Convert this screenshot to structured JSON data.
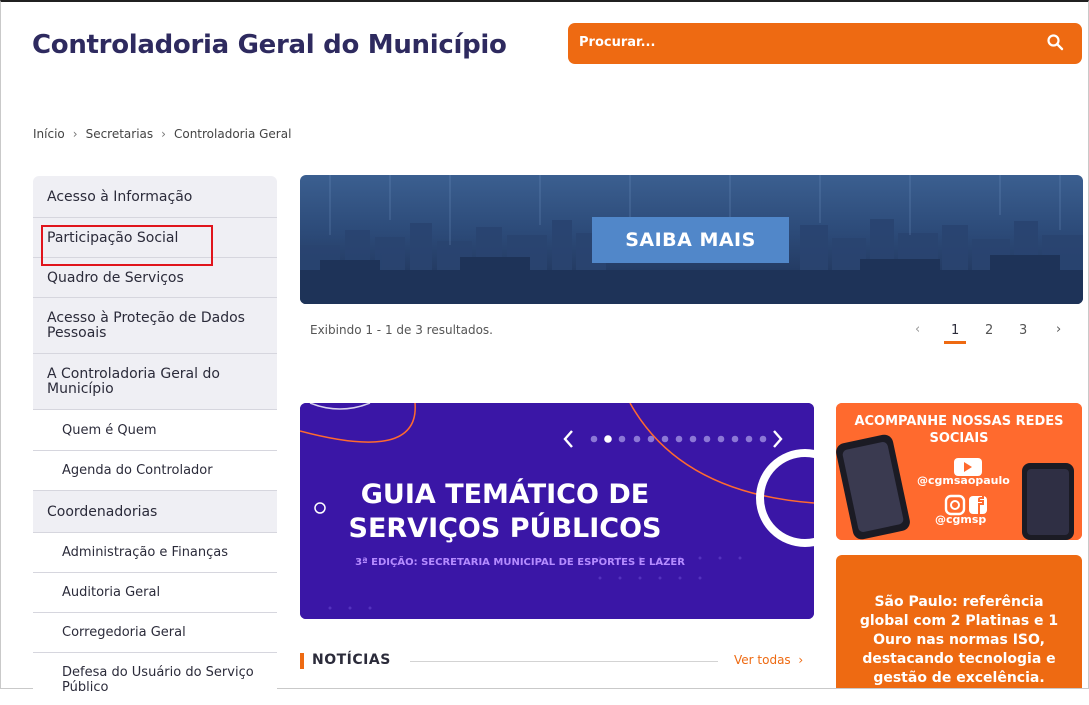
{
  "header": {
    "title": "Controladoria Geral do Município",
    "search_placeholder": "Procurar..."
  },
  "breadcrumb": [
    "Início",
    "Secretarias",
    "Controladoria Geral"
  ],
  "sidebar": {
    "items": [
      {
        "label": "Acesso à Informação"
      },
      {
        "label": "Participação Social"
      },
      {
        "label": "Quadro de Serviços"
      },
      {
        "label": "Acesso à Proteção de Dados Pessoais"
      },
      {
        "label": "A Controladoria Geral do Município"
      },
      {
        "label": "Quem é Quem"
      },
      {
        "label": "Agenda do Controlador"
      },
      {
        "label": "Coordenadorias"
      },
      {
        "label": "Administração e Finanças"
      },
      {
        "label": "Auditoria Geral"
      },
      {
        "label": "Corregedoria Geral"
      },
      {
        "label": "Defesa do Usuário do Serviço Público"
      }
    ]
  },
  "banner": {
    "button_label": "SAIBA MAIS",
    "results_text": "Exibindo 1 - 1 de 3 resultados.",
    "pages": [
      "1",
      "2",
      "3"
    ],
    "current_page": "1"
  },
  "guia": {
    "title": "GUIA TEMÁTICO DE SERVIÇOS PÚBLICOS",
    "subtitle": "3ª EDIÇÃO: SECRETARIA MUNICIPAL DE ESPORTES E LAZER"
  },
  "social": {
    "title": "ACOMPANHE NOSSAS REDES SOCIAIS",
    "youtube_handle": "@cgmsaopaulo",
    "insta_handle": "@cgmsp"
  },
  "ref": {
    "text": "São Paulo: referência global com 2 Platinas e 1 Ouro nas normas ISO, destacando tecnologia e gestão de excelência."
  },
  "news": {
    "title": "NOTÍCIAS",
    "see_all": "Ver todas"
  },
  "colors": {
    "brand_orange": "#ee6a12",
    "title_navy": "#2e2a5f",
    "guia_purple": "#3a16a6",
    "button_blue": "#5187c9"
  }
}
